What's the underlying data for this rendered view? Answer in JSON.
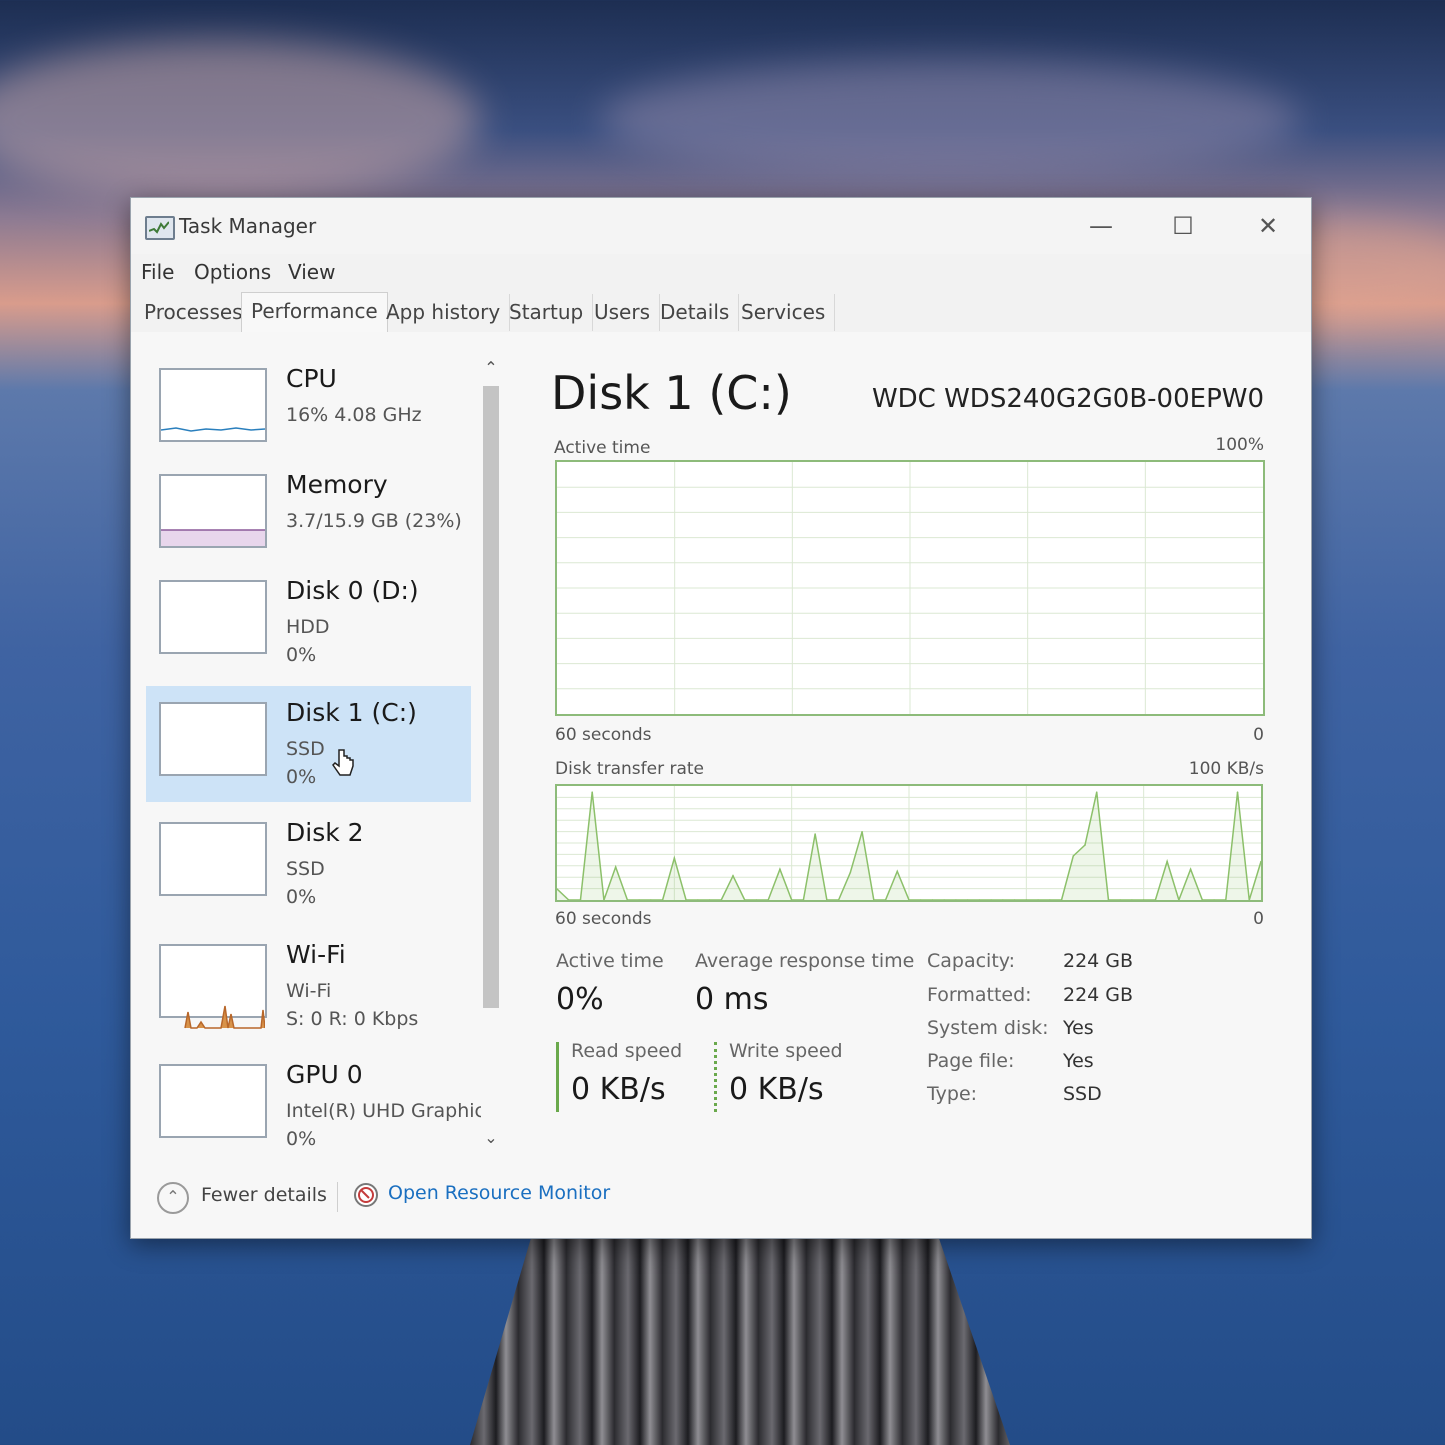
{
  "window": {
    "title": "Task Manager",
    "controls": {
      "minimize": "—",
      "maximize": "☐",
      "close": "✕"
    }
  },
  "menu": [
    "File",
    "Options",
    "View"
  ],
  "tabs": [
    {
      "label": "Processes",
      "active": false
    },
    {
      "label": "Performance",
      "active": true
    },
    {
      "label": "App history",
      "active": false
    },
    {
      "label": "Startup",
      "active": false
    },
    {
      "label": "Users",
      "active": false
    },
    {
      "label": "Details",
      "active": false
    },
    {
      "label": "Services",
      "active": false
    }
  ],
  "sidebar": {
    "items": [
      {
        "name": "CPU",
        "line1": "16%  4.08 GHz",
        "line2": "",
        "selected": false
      },
      {
        "name": "Memory",
        "line1": "3.7/15.9 GB (23%)",
        "line2": "",
        "selected": false
      },
      {
        "name": "Disk 0 (D:)",
        "line1": "HDD",
        "line2": "0%",
        "selected": false
      },
      {
        "name": "Disk 1 (C:)",
        "line1": "SSD",
        "line2": "0%",
        "selected": true
      },
      {
        "name": "Disk 2",
        "line1": "SSD",
        "line2": "0%",
        "selected": false
      },
      {
        "name": "Wi-Fi",
        "line1": "Wi-Fi",
        "line2": "S: 0  R: 0 Kbps",
        "selected": false
      },
      {
        "name": "GPU 0",
        "line1": "Intel(R) UHD Graphics",
        "line2": "0%",
        "selected": false
      }
    ]
  },
  "main": {
    "title": "Disk 1 (C:)",
    "model": "WDC WDS240G2G0B-00EPW0",
    "active_time_graph": {
      "label": "Active time",
      "max": "100%",
      "time_span": "60 seconds",
      "min": "0"
    },
    "transfer_graph": {
      "label": "Disk transfer rate",
      "max": "100 KB/s",
      "time_span": "60 seconds",
      "min": "0"
    },
    "stats": {
      "active_time_label": "Active time",
      "active_time_value": "0%",
      "response_label": "Average response time",
      "response_value": "0 ms",
      "read_label": "Read speed",
      "read_value": "0 KB/s",
      "write_label": "Write speed",
      "write_value": "0 KB/s"
    },
    "properties": [
      {
        "key": "Capacity:",
        "value": "224 GB"
      },
      {
        "key": "Formatted:",
        "value": "224 GB"
      },
      {
        "key": "System disk:",
        "value": "Yes"
      },
      {
        "key": "Page file:",
        "value": "Yes"
      },
      {
        "key": "Type:",
        "value": "SSD"
      }
    ]
  },
  "footer": {
    "fewer_details": "Fewer details",
    "resource_monitor": "Open Resource Monitor"
  },
  "colors": {
    "selected_bg": "#cde3f7",
    "graph_border": "#8dbb7a",
    "graph_line": "#8cc06a",
    "link": "#1a6fc0"
  },
  "chart_data": {
    "type": "line",
    "title": "Disk transfer rate",
    "xlabel": "60 seconds",
    "ylabel": "",
    "ylim": [
      0,
      100
    ],
    "x": [
      0,
      1,
      2,
      3,
      4,
      5,
      6,
      7,
      8,
      9,
      10,
      11,
      12,
      13,
      14,
      15,
      16,
      17,
      18,
      19,
      20,
      21,
      22,
      23,
      24,
      25,
      26,
      27,
      28,
      29,
      30,
      31,
      32,
      33,
      34,
      35,
      36,
      37,
      38,
      39,
      40,
      41,
      42,
      43,
      44,
      45,
      46,
      47,
      48,
      49,
      50,
      51,
      52,
      53,
      54,
      55,
      56,
      57,
      58,
      59,
      60
    ],
    "series": [
      {
        "name": "",
        "values": [
          10,
          0,
          0,
          98,
          0,
          30,
          0,
          0,
          0,
          0,
          38,
          0,
          0,
          0,
          0,
          22,
          0,
          0,
          0,
          28,
          0,
          0,
          60,
          0,
          0,
          25,
          62,
          0,
          0,
          26,
          0,
          0,
          0,
          0,
          0,
          0,
          0,
          0,
          0,
          0,
          0,
          0,
          0,
          0,
          40,
          50,
          98,
          0,
          0,
          0,
          0,
          0,
          35,
          0,
          28,
          0,
          0,
          0,
          98,
          0,
          35
        ]
      }
    ]
  }
}
